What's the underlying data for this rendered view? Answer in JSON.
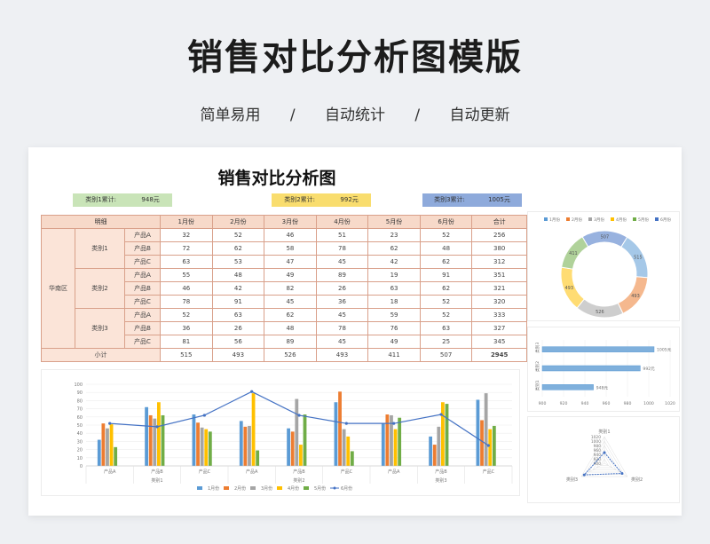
{
  "header": {
    "title": "销售对比分析图模版",
    "tags": [
      "简单易用",
      "自动统计",
      "自动更新"
    ],
    "separator": "/"
  },
  "sheet": {
    "title": "销售对比分析图",
    "chips": [
      {
        "label": "类别1累计:",
        "value": "948元",
        "color": "#c9e4b8"
      },
      {
        "label": "类别2累计:",
        "value": "992元",
        "color": "#f9dd6e"
      },
      {
        "label": "类别3累计:",
        "value": "1005元",
        "color": "#8eaadb"
      }
    ]
  },
  "table": {
    "header": [
      "明细",
      "1月份",
      "2月份",
      "3月份",
      "4月份",
      "5月份",
      "6月份",
      "合计"
    ],
    "region": "华南区",
    "groups": [
      {
        "name": "类别1",
        "rows": [
          {
            "product": "产品A",
            "values": [
              "32",
              "52",
              "46",
              "51",
              "23",
              "52",
              "256"
            ]
          },
          {
            "product": "产品B",
            "values": [
              "72",
              "62",
              "58",
              "78",
              "62",
              "48",
              "380"
            ]
          },
          {
            "product": "产品C",
            "values": [
              "63",
              "53",
              "47",
              "45",
              "42",
              "62",
              "312"
            ]
          }
        ]
      },
      {
        "name": "类别2",
        "rows": [
          {
            "product": "产品A",
            "values": [
              "55",
              "48",
              "49",
              "89",
              "19",
              "91",
              "351"
            ]
          },
          {
            "product": "产品B",
            "values": [
              "46",
              "42",
              "82",
              "26",
              "63",
              "62",
              "321"
            ]
          },
          {
            "product": "产品C",
            "values": [
              "78",
              "91",
              "45",
              "36",
              "18",
              "52",
              "320"
            ]
          }
        ]
      },
      {
        "name": "类别3",
        "rows": [
          {
            "product": "产品A",
            "values": [
              "52",
              "63",
              "62",
              "45",
              "59",
              "52",
              "333"
            ]
          },
          {
            "product": "产品B",
            "values": [
              "36",
              "26",
              "48",
              "78",
              "76",
              "63",
              "327"
            ]
          },
          {
            "product": "产品C",
            "values": [
              "81",
              "56",
              "89",
              "45",
              "49",
              "25",
              "345"
            ]
          }
        ]
      }
    ],
    "subtotal": {
      "label": "小计",
      "values": [
        "515",
        "493",
        "526",
        "493",
        "411",
        "507",
        "2945"
      ]
    }
  },
  "chart_data": [
    {
      "type": "bar",
      "title": "",
      "series_colors": [
        "#5b9bd5",
        "#ed7d31",
        "#a5a5a5",
        "#ffc000",
        "#70ad47",
        "#4472c4"
      ],
      "ylim": [
        0,
        100
      ],
      "yticks": [
        "0",
        "10",
        "20",
        "30",
        "40",
        "50",
        "60",
        "70",
        "80",
        "90",
        "100"
      ],
      "categories": [
        "产品A",
        "产品B",
        "产品C",
        "产品A",
        "产品B",
        "产品C",
        "产品A",
        "产品B",
        "产品C"
      ],
      "groups": [
        "类别1",
        "类别2",
        "类别3"
      ],
      "series": [
        {
          "name": "1月份",
          "values": [
            32,
            72,
            63,
            55,
            46,
            78,
            52,
            36,
            81
          ]
        },
        {
          "name": "2月份",
          "values": [
            52,
            62,
            53,
            48,
            42,
            91,
            63,
            26,
            56
          ]
        },
        {
          "name": "3月份",
          "values": [
            46,
            58,
            47,
            49,
            82,
            45,
            62,
            48,
            89
          ]
        },
        {
          "name": "4月份",
          "values": [
            51,
            78,
            45,
            89,
            26,
            36,
            45,
            78,
            45
          ]
        },
        {
          "name": "5月份",
          "values": [
            23,
            62,
            42,
            19,
            63,
            18,
            59,
            76,
            49
          ]
        },
        {
          "name": "6月份",
          "values": [
            52,
            48,
            62,
            91,
            62,
            52,
            52,
            63,
            25
          ],
          "style": "line"
        }
      ]
    },
    {
      "type": "pie",
      "legend": [
        "1月份",
        "2月份",
        "3月份",
        "4月份",
        "5月份",
        "6月份"
      ],
      "values": [
        515,
        493,
        526,
        493,
        411,
        507
      ]
    },
    {
      "type": "bar",
      "orientation": "horizontal",
      "categories": [
        "类别1",
        "类别2",
        "类别3"
      ],
      "values": [
        948,
        992,
        1005
      ],
      "labels": [
        "948元",
        "992元",
        "1005元"
      ],
      "xticks": [
        "900",
        "920",
        "940",
        "960",
        "980",
        "1000",
        "1020"
      ],
      "xlim": [
        900,
        1020
      ]
    },
    {
      "type": "radar",
      "categories": [
        "类别1",
        "类别2",
        "类别3"
      ],
      "values": [
        948,
        992,
        1005
      ],
      "rticks": [
        "900",
        "920",
        "940",
        "960",
        "980",
        "1000",
        "1020"
      ],
      "rlim": [
        900,
        1020
      ]
    }
  ]
}
